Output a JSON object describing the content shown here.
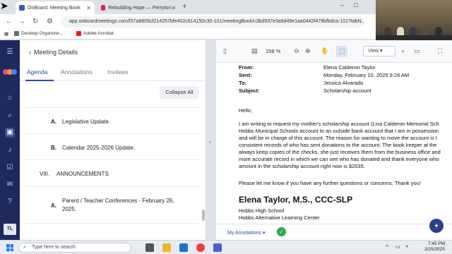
{
  "browser": {
    "tabs": [
      {
        "title": "OnBoard: Meeting Book",
        "active": true
      },
      {
        "title": "Rebuilding Hope — Perryton",
        "active": false
      }
    ],
    "url": "app.onboardmeetings.com/f37a8805cf214257bfe402c614150c30-101/meetingBook/c3bd937e3a9d49e1aa0442f479bfbdca-101?tabN...",
    "bookmarks": [
      "Desktop Organizer...",
      "Adobe Acrobat"
    ],
    "new_tab": "+",
    "window_controls": [
      "–",
      "□",
      "✕"
    ]
  },
  "rail": {
    "avatar": "TL"
  },
  "panel": {
    "title": "Meeting Details",
    "tabs": [
      "Agenda",
      "Annotations",
      "Invitees"
    ],
    "collapse_label": "Collapse All",
    "items": [
      {
        "letter": "A.",
        "text": "Legislative Update."
      },
      {
        "letter": "B.",
        "text": "Calendar 2025-2026 Update."
      },
      {
        "roman": "VIII.",
        "text": "ANNOUNCEMENTS"
      },
      {
        "letter": "A.",
        "text": "Parent / Teacher Conferences - February 26,",
        "text2": "2025."
      }
    ]
  },
  "viewer": {
    "zoom": "158 %",
    "view_label": "View",
    "email": {
      "from_label": "From:",
      "from": "Elena Calderon Taylor",
      "sent_label": "Sent:",
      "sent": "Monday, February 10, 2025 9:26 AM",
      "to_label": "To:",
      "to": "Jessica Alvarado",
      "subject_label": "Subject:",
      "subject": "Scholarship account",
      "greeting": "Hello,",
      "body": [
        "I am writing to request my mother's scholarship account (Lisa Calderon Memorial Sch",
        "Hobbs Municipal Schools account to an outside bank account that I am in possession",
        "and will be in charge of this account. The reason for wanting to move the account is l",
        "consistent records of who has sent donations to the account. The book keeper at the",
        "always keep copies of the checks, she just receives them from the business office and",
        "more accurate record in which we can see who has donated and thank everyone who",
        "amount in the scholarship account right now is $2035."
      ],
      "closing": "Please let me know if you have any further questions or concerns. Thank you!",
      "signature": "Elena Taylor, M.S., CCC-SLP",
      "signature_lines": [
        "Hobbs High School",
        "Hobbs Alternative Learning Center"
      ]
    },
    "footer_label": "My Annotations",
    "footer_caret": "▾"
  },
  "taskbar": {
    "search_placeholder": "Type here to search",
    "time": "7:45 PM",
    "date": "2/25/2025"
  },
  "colors": {
    "rail": "#1d2a5b",
    "accent": "#2b4aa0",
    "check": "#2fa84f"
  }
}
